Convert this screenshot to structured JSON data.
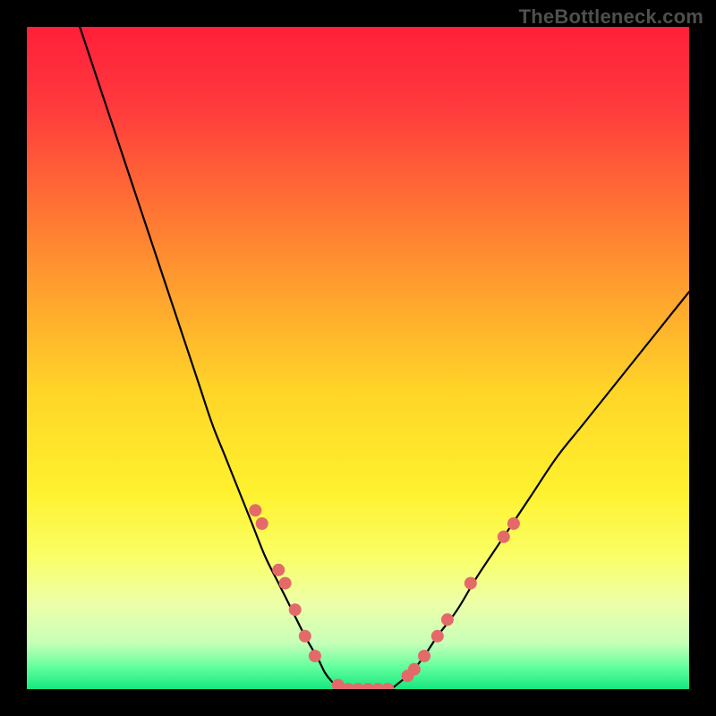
{
  "watermark": "TheBottleneck.com",
  "chart_data": {
    "type": "line",
    "title": "",
    "xlabel": "",
    "ylabel": "",
    "xlim": [
      0,
      100
    ],
    "ylim": [
      0,
      100
    ],
    "grid": false,
    "legend": false,
    "background": {
      "type": "vertical-gradient",
      "stops": [
        {
          "at": 0.0,
          "color": "#ff1f3a"
        },
        {
          "at": 0.12,
          "color": "#ff3a3d"
        },
        {
          "at": 0.25,
          "color": "#ff6a35"
        },
        {
          "at": 0.4,
          "color": "#ffa12e"
        },
        {
          "at": 0.55,
          "color": "#ffd528"
        },
        {
          "at": 0.7,
          "color": "#fff12e"
        },
        {
          "at": 0.8,
          "color": "#faff66"
        },
        {
          "at": 0.87,
          "color": "#edffa8"
        },
        {
          "at": 0.93,
          "color": "#c8ffb8"
        },
        {
          "at": 0.965,
          "color": "#67ff9f"
        },
        {
          "at": 1.0,
          "color": "#15e87e"
        }
      ]
    },
    "series": [
      {
        "name": "curve-left",
        "color": "#000000",
        "width": 2.2,
        "x": [
          8,
          10,
          12,
          14,
          16,
          18,
          20,
          22,
          24,
          26,
          28,
          30,
          32,
          34,
          36,
          38,
          40,
          42,
          44,
          45,
          46,
          47,
          48
        ],
        "y": [
          100,
          94,
          88,
          82,
          76,
          70,
          64,
          58,
          52,
          46,
          40,
          35,
          30,
          25,
          20,
          16,
          12,
          8,
          4.5,
          2.5,
          1.2,
          0.4,
          0
        ]
      },
      {
        "name": "curve-flat",
        "color": "#000000",
        "width": 2.2,
        "x": [
          48,
          49,
          50,
          51,
          52,
          53,
          54,
          55
        ],
        "y": [
          0,
          0,
          0,
          0,
          0,
          0,
          0,
          0
        ]
      },
      {
        "name": "curve-right",
        "color": "#000000",
        "width": 2.2,
        "x": [
          55,
          56,
          58,
          60,
          62,
          65,
          68,
          72,
          76,
          80,
          84,
          88,
          92,
          96,
          100
        ],
        "y": [
          0,
          0.8,
          2.5,
          5,
          8,
          12,
          17,
          23,
          29,
          35,
          40,
          45,
          50,
          55,
          60
        ]
      }
    ],
    "markers": {
      "name": "highlight-dots",
      "color": "#e46a6a",
      "radius": 7,
      "points": [
        {
          "x": 34.5,
          "y": 27
        },
        {
          "x": 35.5,
          "y": 25
        },
        {
          "x": 38.0,
          "y": 18
        },
        {
          "x": 39.0,
          "y": 16
        },
        {
          "x": 40.5,
          "y": 12
        },
        {
          "x": 42.0,
          "y": 8
        },
        {
          "x": 43.5,
          "y": 5
        },
        {
          "x": 47.0,
          "y": 0.6
        },
        {
          "x": 48.5,
          "y": 0
        },
        {
          "x": 50.0,
          "y": 0
        },
        {
          "x": 51.5,
          "y": 0
        },
        {
          "x": 53.0,
          "y": 0
        },
        {
          "x": 54.5,
          "y": 0
        },
        {
          "x": 57.5,
          "y": 2
        },
        {
          "x": 58.5,
          "y": 3
        },
        {
          "x": 60.0,
          "y": 5
        },
        {
          "x": 62.0,
          "y": 8
        },
        {
          "x": 63.5,
          "y": 10.5
        },
        {
          "x": 67.0,
          "y": 16
        },
        {
          "x": 72.0,
          "y": 23
        },
        {
          "x": 73.5,
          "y": 25
        }
      ]
    }
  }
}
